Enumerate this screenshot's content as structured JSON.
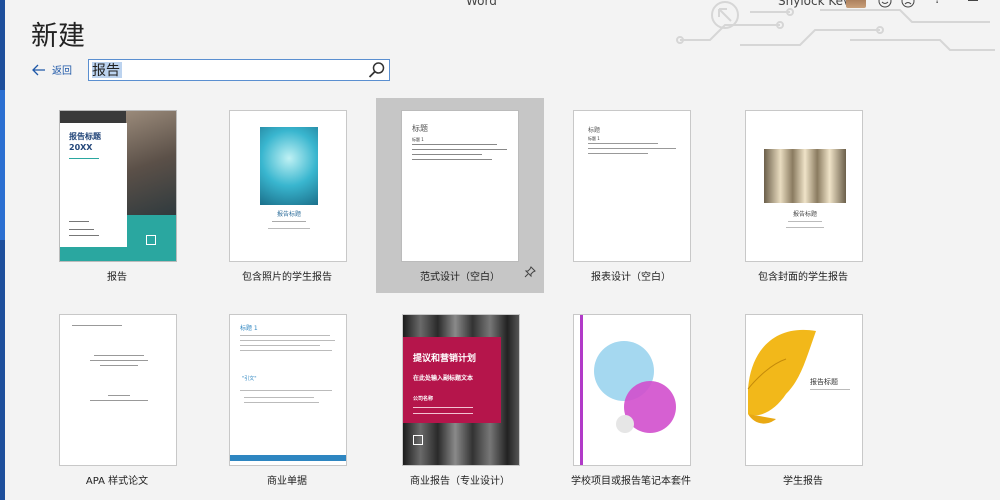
{
  "window": {
    "app_name": "Word",
    "user_name": "Shylock Kevin"
  },
  "header": {
    "title": "新建",
    "back_label": "返回"
  },
  "search": {
    "value": "报告"
  },
  "templates": [
    {
      "label": "报告",
      "thumb_title": "报告标题",
      "thumb_year": "20XX"
    },
    {
      "label": "包含照片的学生报告",
      "thumb_title": "报告标题"
    },
    {
      "label": "范式设计（空白）",
      "thumb_title": "标题",
      "thumb_heading": "标题 1"
    },
    {
      "label": "报表设计（空白）",
      "thumb_title": "标题",
      "thumb_heading": "标题 1"
    },
    {
      "label": "包含封面的学生报告",
      "thumb_title": "报告标题"
    },
    {
      "label": "APA 样式论文"
    },
    {
      "label": "商业单据",
      "thumb_title": "标题 1",
      "thumb_quote": "\"引文\""
    },
    {
      "label": "商业报告（专业设计）",
      "thumb_title": "提议和营销计划",
      "thumb_subtitle": "在此处输入副标题文本",
      "thumb_company": "公司名称"
    },
    {
      "label": "学校项目或报告笔记本套件"
    },
    {
      "label": "学生报告",
      "thumb_title": "报告标题"
    }
  ],
  "colors": {
    "accent": "#1f58a8",
    "teal": "#2aa7a0",
    "crimson": "#b5154b",
    "purple": "#b13ac8"
  }
}
